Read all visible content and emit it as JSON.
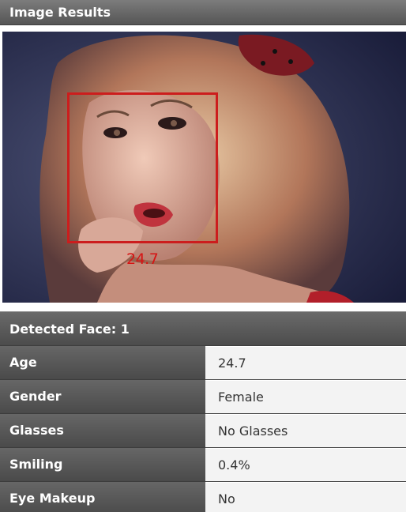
{
  "header": {
    "title": "Image Results"
  },
  "image": {
    "face_label": "24.7",
    "box_color": "#cc1d1d"
  },
  "detected": {
    "title": "Detected Face: 1"
  },
  "attributes": [
    {
      "label": "Age",
      "value": "24.7"
    },
    {
      "label": "Gender",
      "value": "Female"
    },
    {
      "label": "Glasses",
      "value": "No Glasses"
    },
    {
      "label": "Smiling",
      "value": "0.4%"
    },
    {
      "label": "Eye Makeup",
      "value": "No"
    }
  ]
}
